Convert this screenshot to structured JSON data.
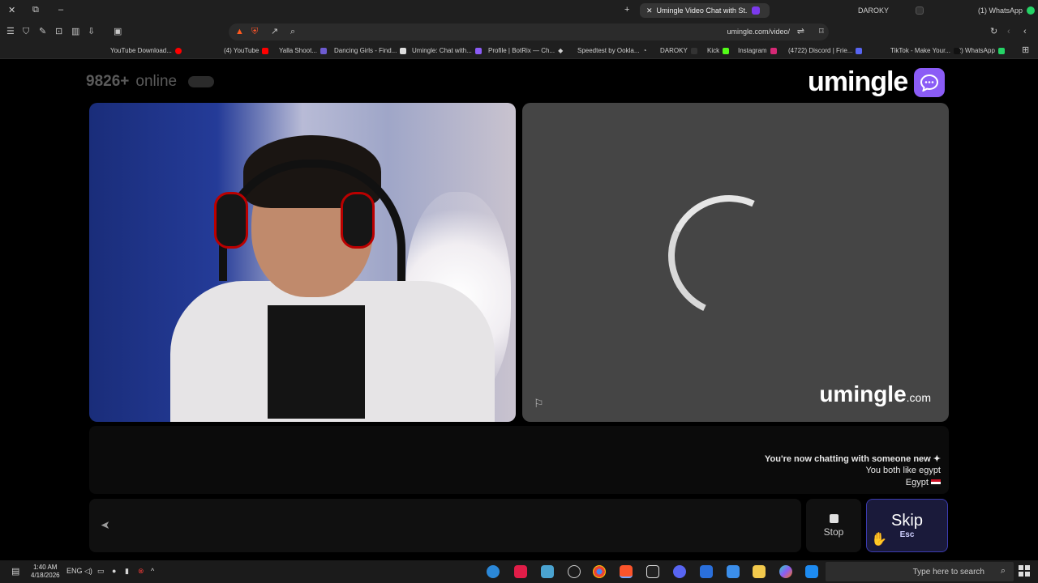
{
  "browser": {
    "tabs": [
      {
        "label": "Umingle Video Chat with St...",
        "active": true
      },
      {
        "label": "DAROKY",
        "active": false
      },
      {
        "label": "(1) WhatsApp",
        "active": false
      }
    ],
    "new_tab_glyph": "+",
    "address": "umingle.com/video/",
    "bookmarks": [
      "(2) WhatsApp",
      "TikTok - Make Your...",
      "(4722) Discord | Frie...",
      "Instagram",
      "Kick",
      "DAROKY",
      "Speedtest by Ookla...",
      "Profile | BotRix — Ch...",
      "Umingle: Chat with...",
      "Dancing Girls - Find...",
      "Yalla Shoot...",
      "(4) YouTube",
      "YouTube Download..."
    ]
  },
  "page": {
    "logo_text": "umingle",
    "online_count": "9826+",
    "online_label": "online",
    "watermark_main": "umingle",
    "watermark_suffix": ".com",
    "report_glyph": "⚐",
    "messages": {
      "line1": "You're now chatting with someone new",
      "line2": "You both like egypt",
      "line3": "Egypt"
    },
    "send_glyph": "➤",
    "stop_label": "Stop",
    "skip_label": "Skip",
    "skip_hint": "Esc"
  },
  "taskbar": {
    "search_placeholder": "Type here to search",
    "time": "1:40 AM",
    "date": "4/18/2026",
    "lang": "ENG"
  },
  "colors": {
    "accent": "#8b5cf6",
    "page_bg": "#000000",
    "remote_video_bg": "#454545"
  }
}
